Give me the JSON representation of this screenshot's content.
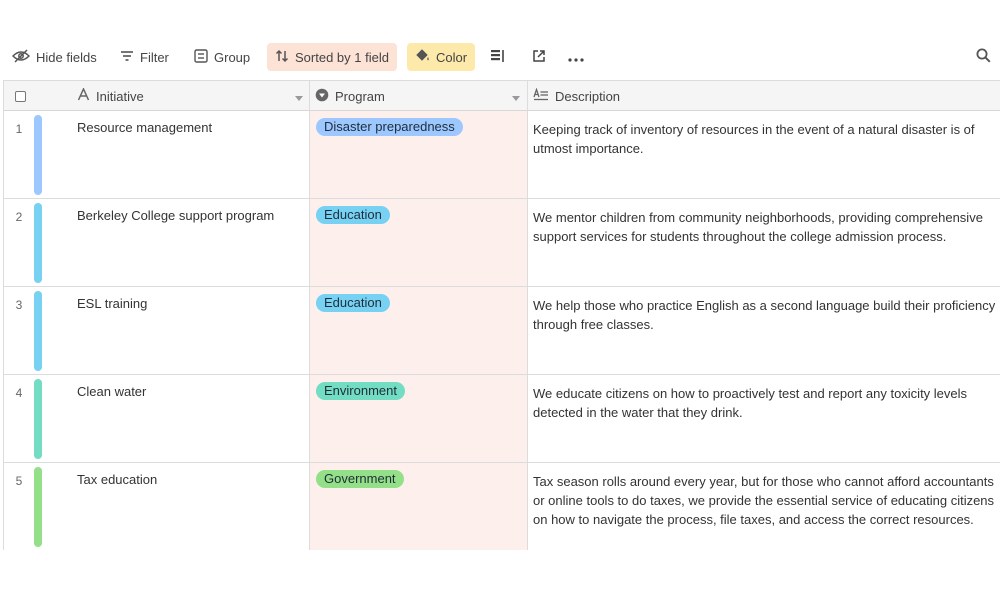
{
  "toolbar": {
    "hide_fields": "Hide fields",
    "filter": "Filter",
    "group": "Group",
    "sorted": "Sorted by 1 field",
    "color": "Color",
    "icons": [
      "eye-off-icon",
      "filter-icon",
      "group-icon",
      "sort-icon",
      "paint-bucket-icon",
      "row-height-icon",
      "share-view-icon",
      "more-icon",
      "search-icon"
    ],
    "sorted_bg": "#fde2d6",
    "color_bg": "#fde9a9"
  },
  "columns": {
    "initiative": "Initiative",
    "program": "Program",
    "description": "Description"
  },
  "rows": [
    {
      "num": "1",
      "initiative": "Resource management",
      "program": "Disaster preparedness",
      "program_color": "#9cc7ff",
      "stripe_color": "#9cc7ff",
      "description": "Keeping track of inventory of resources in the event of a natural disaster is of utmost importance."
    },
    {
      "num": "2",
      "initiative": "Berkeley College support program",
      "program": "Education",
      "program_color": "#77d1f3",
      "stripe_color": "#77d1f3",
      "description": "We mentor children from community neighborhoods, providing comprehensive support services for students throughout the college admission process."
    },
    {
      "num": "3",
      "initiative": "ESL training",
      "program": "Education",
      "program_color": "#77d1f3",
      "stripe_color": "#77d1f3",
      "description": "We help those who practice English as a second language build their proficiency through free classes."
    },
    {
      "num": "4",
      "initiative": "Clean water",
      "program": "Environment",
      "program_color": "#72ddc3",
      "stripe_color": "#72ddc3",
      "description": "We educate citizens on how to proactively test and report any toxicity levels detected in the water that they drink."
    },
    {
      "num": "5",
      "initiative": "Tax education",
      "program": "Government",
      "program_color": "#93e088",
      "stripe_color": "#93e088",
      "description": "Tax season rolls around every year, but for those who cannot afford accountants or online tools to do taxes, we provide the essential service of educating citizens on how to navigate the process, file taxes, and access the correct resources."
    }
  ]
}
